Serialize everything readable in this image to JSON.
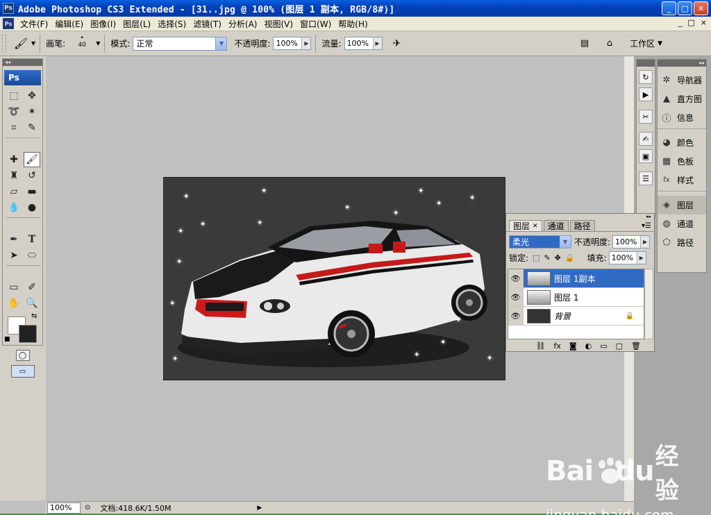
{
  "window": {
    "title": "Adobe Photoshop CS3 Extended - [31..jpg @ 100% (图层 1 副本, RGB/8#)]",
    "app_icon": "Ps",
    "minimize": "_",
    "maximize": "□",
    "close": "✕"
  },
  "menubar": {
    "icon": "Ps",
    "items": [
      "文件(F)",
      "编辑(E)",
      "图像(I)",
      "图层(L)",
      "选择(S)",
      "滤镜(T)",
      "分析(A)",
      "视图(V)",
      "窗口(W)",
      "帮助(H)"
    ],
    "doc_controls": [
      "_",
      "□",
      "×"
    ]
  },
  "options": {
    "brush_label": "画笔:",
    "brush_size": "40",
    "mode_label": "模式:",
    "mode_value": "正常",
    "opacity_label": "不透明度:",
    "opacity_value": "100%",
    "flow_label": "流量:",
    "flow_value": "100%",
    "workspace_label": "工作区"
  },
  "toolbox": {
    "logo": "Ps",
    "foreground_color": "#ffffff",
    "background_color": "#222222"
  },
  "canvas": {
    "background_color": "#3a3a3a"
  },
  "statusbar": {
    "zoom": "100%",
    "doc_info": "文档:418.6K/1.50M"
  },
  "dock": {
    "group1": [
      "导航器",
      "直方图",
      "信息"
    ],
    "group2": [
      "颜色",
      "色板",
      "样式"
    ],
    "group3": [
      "图层",
      "通道",
      "路径"
    ],
    "selected": "图层"
  },
  "layers_panel": {
    "tabs": [
      "图层",
      "通道",
      "路径"
    ],
    "blend_mode": "柔光",
    "opacity_label": "不透明度:",
    "opacity_value": "100%",
    "lock_label": "锁定:",
    "fill_label": "填充:",
    "fill_value": "100%",
    "layers": [
      {
        "name": "图层 1副本",
        "selected": true
      },
      {
        "name": "图层 1",
        "selected": false
      },
      {
        "name": "背景",
        "selected": false,
        "locked": true
      }
    ]
  },
  "watermark": {
    "brand_left": "Bai",
    "brand_right": "du",
    "brand_cn": "经验",
    "url": "jingyan.baidu.com"
  },
  "colors": {
    "accent": "#316ac5",
    "title_blue": "#0442b8"
  }
}
